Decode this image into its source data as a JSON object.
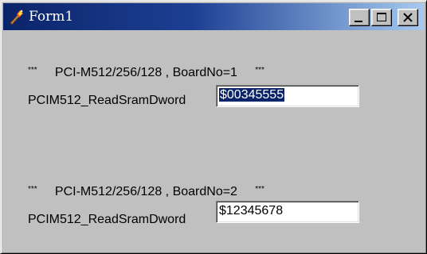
{
  "window": {
    "title": "Form1",
    "controls": {
      "minimize": "minimize",
      "maximize": "maximize",
      "close": "close"
    }
  },
  "board1": {
    "stars_left": "***",
    "header": "PCI-M512/256/128 , BoardNo=1",
    "stars_right": "***",
    "label": "PCIM512_ReadSramDword",
    "value": "$00345555",
    "value_selected": true
  },
  "board2": {
    "stars_left": "***",
    "header": "PCI-M512/256/128 , BoardNo=2",
    "stars_right": "***",
    "label": "PCIM512_ReadSramDword",
    "value": "$12345678",
    "value_selected": false
  },
  "colors": {
    "titlebar_start": "#0a246a",
    "titlebar_end": "#a6caf0",
    "face": "#c0c0c0",
    "selection": "#0a246a"
  }
}
